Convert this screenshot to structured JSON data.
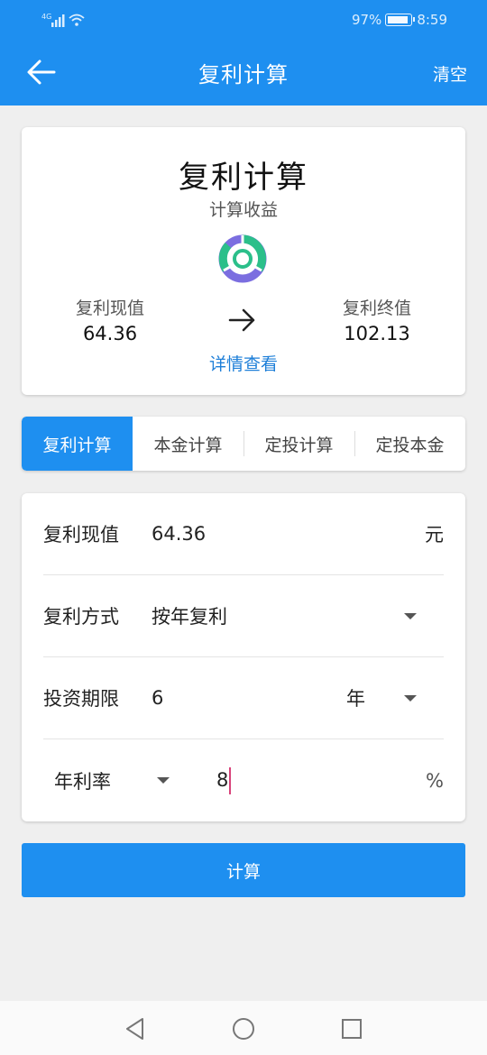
{
  "status_bar": {
    "network": "4G",
    "battery": "97%",
    "time": "8:59"
  },
  "app_bar": {
    "title": "复利计算",
    "back_icon": "arrow-left-icon",
    "clear_label": "清空"
  },
  "summary": {
    "title": "复利计算",
    "subtitle": "计算收益",
    "present_value_label": "复利现值",
    "present_value": "64.36",
    "future_value_label": "复利终值",
    "future_value": "102.13",
    "details_link": "详情查看",
    "chart_icon": "donut-chart-icon",
    "arrow_icon": "arrow-right-icon"
  },
  "tabs": [
    {
      "label": "复利计算",
      "active": true
    },
    {
      "label": "本金计算",
      "active": false
    },
    {
      "label": "定投计算",
      "active": false
    },
    {
      "label": "定投本金",
      "active": false
    }
  ],
  "form": {
    "present_value": {
      "label": "复利现值",
      "value": "64.36",
      "unit": "元"
    },
    "compound_mode": {
      "label": "复利方式",
      "value": "按年复利"
    },
    "term": {
      "label": "投资期限",
      "value": "6",
      "unit": "年"
    },
    "rate": {
      "label": "年利率",
      "value": "8",
      "unit": "%"
    }
  },
  "calculate_button": "计算",
  "colors": {
    "primary": "#1e8ff0",
    "link": "#1e7fd8",
    "donut_green": "#2bbf8a",
    "donut_purple": "#7b6ee0",
    "cursor": "#d8437a"
  },
  "nav_bar": {
    "back_icon": "triangle-back-icon",
    "home_icon": "circle-home-icon",
    "recents_icon": "square-recents-icon"
  }
}
